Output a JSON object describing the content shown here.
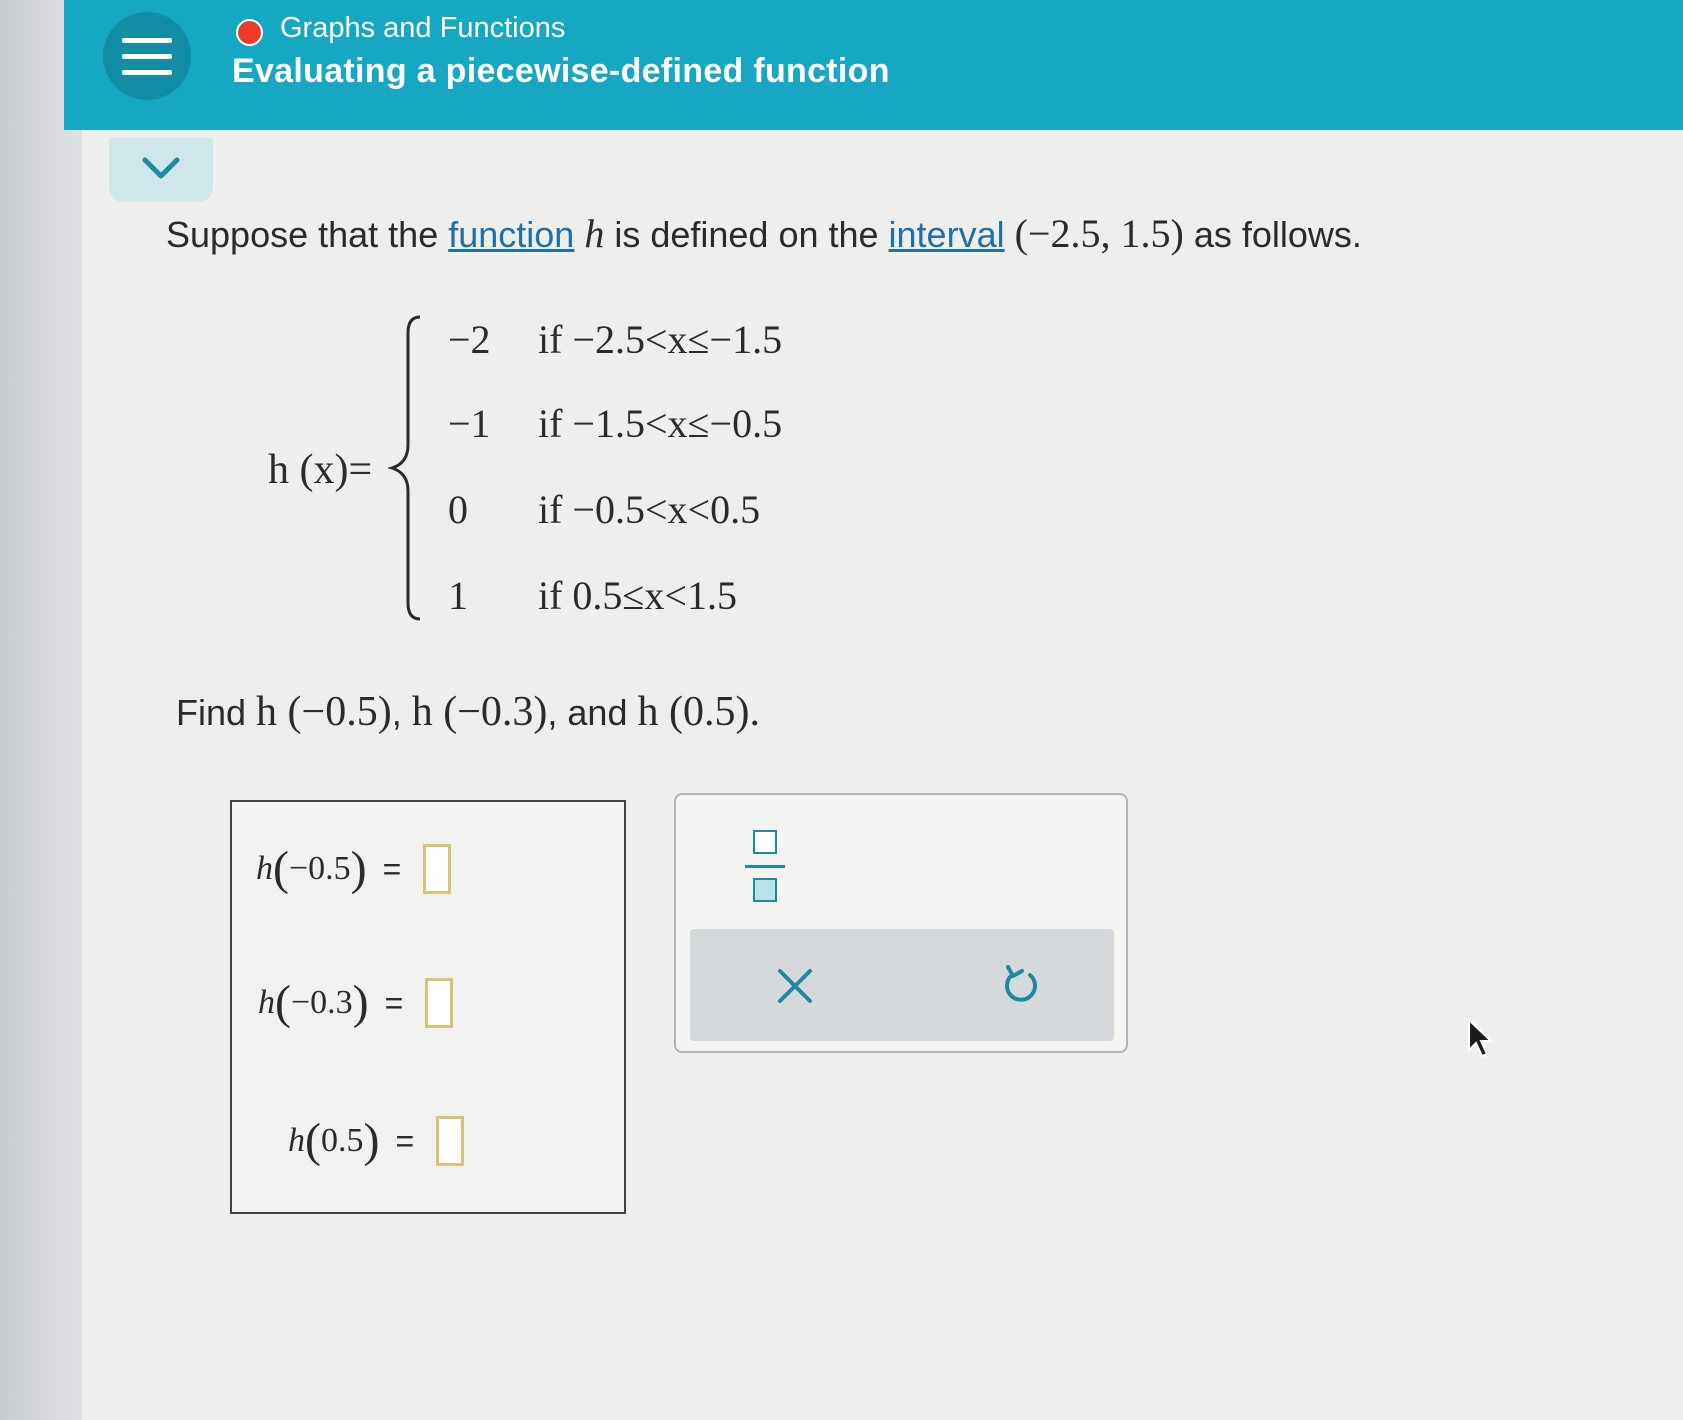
{
  "header": {
    "topic": "Graphs and Functions",
    "title": "Evaluating a piecewise-defined function",
    "status_color": "#ee3b2b",
    "accent_color": "#16a7c2"
  },
  "question": {
    "intro_1": "Suppose that the ",
    "link_function": "function",
    "var_h": "h",
    "intro_2": " is defined on the ",
    "link_interval": "interval",
    "interval": "(−2.5,  1.5)",
    "intro_3": " as follows."
  },
  "piecewise": {
    "lhs": "h (x)=",
    "cases": [
      {
        "value": "−2",
        "condition": "if −2.5<x≤−1.5"
      },
      {
        "value": "−1",
        "condition": "if −1.5<x≤−0.5"
      },
      {
        "value": "0",
        "condition": "if −0.5<x<0.5"
      },
      {
        "value": "1",
        "condition": "if 0.5≤x<1.5"
      }
    ]
  },
  "find": {
    "prefix": "Find ",
    "e1": "h (−0.5)",
    "sep1": ", ",
    "e2": "h (−0.3)",
    "sep2": ", and ",
    "e3": "h (0.5)",
    "suffix": "."
  },
  "answers": [
    {
      "fn": "h",
      "arg": "−0.5",
      "eq": "=",
      "value": ""
    },
    {
      "fn": "h",
      "arg": "−0.3",
      "eq": "=",
      "value": ""
    },
    {
      "fn": "h",
      "arg": "0.5",
      "eq": "=",
      "value": ""
    }
  ],
  "tools": {
    "fraction_icon": "fraction-icon",
    "clear_icon": "close-icon",
    "undo_icon": "undo-icon"
  },
  "icons": {
    "menu": "hamburger-menu-icon",
    "collapse": "chevron-down-icon"
  }
}
